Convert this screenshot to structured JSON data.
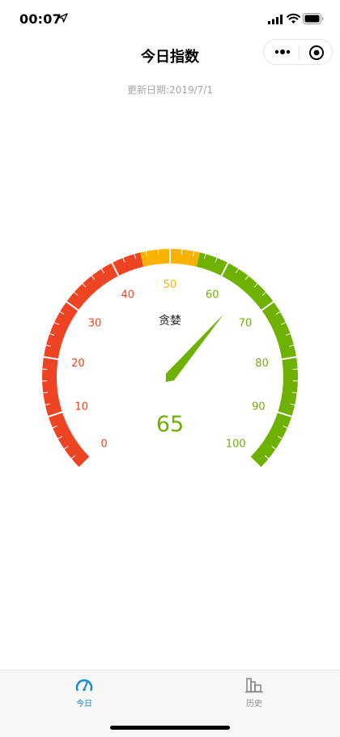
{
  "status_bar": {
    "time": "00:07"
  },
  "nav": {
    "title": "今日指数"
  },
  "update_date": "更新日期:2019/7/1",
  "gauge": {
    "min": 0,
    "max": 100,
    "value": 65,
    "value_label": "65",
    "title": "贪婪",
    "tick_labels": [
      "0",
      "10",
      "20",
      "30",
      "40",
      "50",
      "60",
      "70",
      "80",
      "90",
      "100"
    ],
    "bands": [
      {
        "from": 0,
        "to": 45,
        "color": "#ee4423"
      },
      {
        "from": 45,
        "to": 55,
        "color": "#f9b200"
      },
      {
        "from": 55,
        "to": 100,
        "color": "#6fb100"
      }
    ],
    "pointer_color": "#6fb100"
  },
  "tabs": [
    {
      "label": "今日",
      "icon": "gauge-icon",
      "active": true
    },
    {
      "label": "历史",
      "icon": "bar-chart-icon",
      "active": false
    }
  ],
  "colors": {
    "accent": "#1c8fd6",
    "inactive": "#8a8a8a"
  }
}
